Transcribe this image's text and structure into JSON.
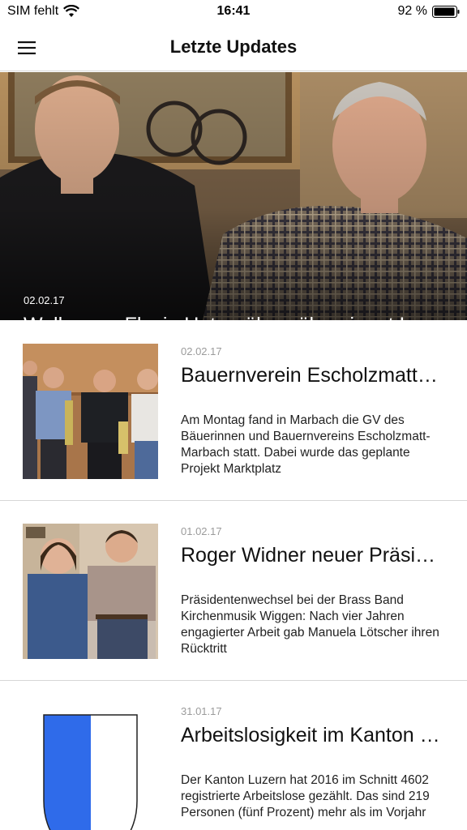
{
  "status_bar": {
    "carrier": "SIM fehlt",
    "time": "16:41",
    "battery": "92 %"
  },
  "nav": {
    "title": "Letzte Updates",
    "menu_icon": "hamburger-icon"
  },
  "hero": {
    "date": "02.02.17",
    "title": "Wolhusen: Flavio Unternährer übernimmt Leitung"
  },
  "articles": [
    {
      "date": "02.02.17",
      "title": "Bauernverein Escholzmatt-Marbach",
      "excerpt": "Am Montag fand in Marbach die GV des Bäuerinnen und Bauernvereins Escholzmatt-Marbach statt. Dabei wurde das geplante Projekt Marktplatz"
    },
    {
      "date": "01.02.17",
      "title": "Roger Widner neuer Präsident",
      "excerpt": "Präsidentenwechsel bei der Brass Band Kirchenmusik Wiggen: Nach vier Jahren engagierter Arbeit gab Manuela Lötscher ihren Rücktritt"
    },
    {
      "date": "31.01.17",
      "title": "Arbeitslosigkeit im Kanton Luzern",
      "excerpt": "Der Kanton Luzern hat 2016 im Schnitt 4602 registrierte Arbeitslose gezählt. Das sind 219 Personen (fünf Prozent) mehr als im Vorjahr"
    }
  ],
  "colors": {
    "accent_blue": "#2f6bea",
    "divider": "#d6d6d6",
    "date_gray": "#9b9b9b"
  }
}
